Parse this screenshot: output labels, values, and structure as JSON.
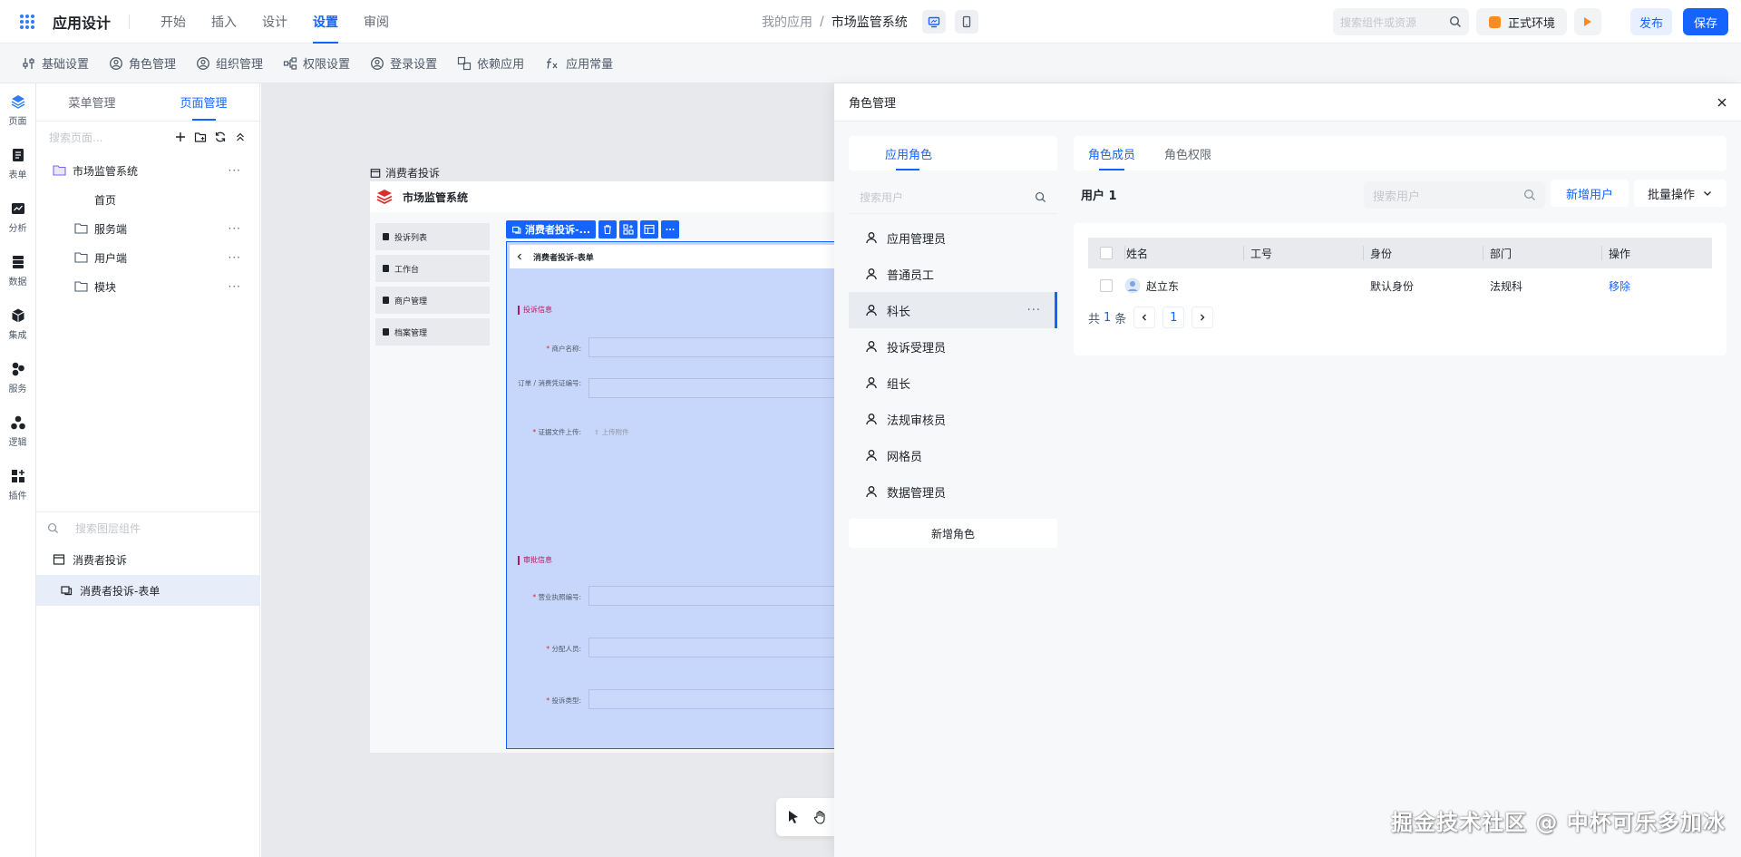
{
  "topbar": {
    "app_title": "应用设计",
    "nav": [
      "开始",
      "插入",
      "设计",
      "设置",
      "审阅"
    ],
    "active_nav": "设置",
    "breadcrumb_parent": "我的应用",
    "breadcrumb_sep": "/",
    "breadcrumb_current": "市场监管系统",
    "search_placeholder": "搜索组件或资源",
    "env_label": "正式环境",
    "publish_label": "发布",
    "save_label": "保存"
  },
  "settings_bar": [
    "基础设置",
    "角色管理",
    "组织管理",
    "权限设置",
    "登录设置",
    "依赖应用",
    "应用常量"
  ],
  "rail": [
    "页面",
    "表单",
    "分析",
    "数据",
    "集成",
    "服务",
    "逻辑",
    "插件"
  ],
  "page_panel": {
    "tabs": [
      "菜单管理",
      "页面管理"
    ],
    "search_placeholder": "搜索页面...",
    "tree": {
      "root": "市场监管系统",
      "children": [
        "首页",
        "服务端",
        "用户端",
        "模块"
      ]
    },
    "layer_search_placeholder": "搜索图层组件",
    "layers": [
      "消费者投诉",
      "消费者投诉-表单"
    ]
  },
  "canvas": {
    "page_label": "消费者投诉",
    "app_name": "市场监管系统",
    "nav_items": [
      "投诉列表",
      "工作台",
      "商户管理",
      "档案管理"
    ],
    "selected_component": "消费者投诉-...",
    "form_title": "消费者投诉-表单",
    "section1": "投诉信息",
    "fields1": [
      {
        "label": "商户名称:",
        "required": true
      },
      {
        "label": "订单 / 消费凭证编号:",
        "required": false
      },
      {
        "label": "证据文件上传:",
        "required": true
      }
    ],
    "upload_text": "上传附件",
    "section2": "审批信息",
    "fields2": [
      {
        "label": "营业执照编号:",
        "required": true
      },
      {
        "label": "分配人员:",
        "required": true
      },
      {
        "label": "投诉类型:",
        "required": true
      }
    ]
  },
  "drawer": {
    "title": "角色管理",
    "role_tab": "应用角色",
    "role_search_placeholder": "搜索用户",
    "roles": [
      "应用管理员",
      "普通员工",
      "科长",
      "投诉受理员",
      "组长",
      "法规审核员",
      "网格员",
      "数据管理员"
    ],
    "active_role": "科长",
    "add_role_label": "新增角色",
    "member_tabs": [
      "角色成员",
      "角色权限"
    ],
    "user_count_label": "用户 1",
    "member_search_placeholder": "搜索用户",
    "add_user_label": "新增用户",
    "batch_label": "批量操作",
    "table": {
      "headers": [
        "姓名",
        "工号",
        "身份",
        "部门",
        "操作"
      ],
      "rows": [
        {
          "name": "赵立东",
          "employee_id": "",
          "identity": "默认身份",
          "department": "法规科",
          "action": "移除"
        }
      ]
    },
    "pagination": {
      "total_prefix": "共",
      "total": "1",
      "total_suffix": "条",
      "current_page": "1"
    }
  },
  "watermark": "掘金技术社区 @ 中杯可乐多加冰",
  "colors": {
    "accent": "#1664ff",
    "env_badge": "#ff8a1e",
    "section_title": "#b2185a",
    "selection_fill": "#c7d7fb"
  }
}
